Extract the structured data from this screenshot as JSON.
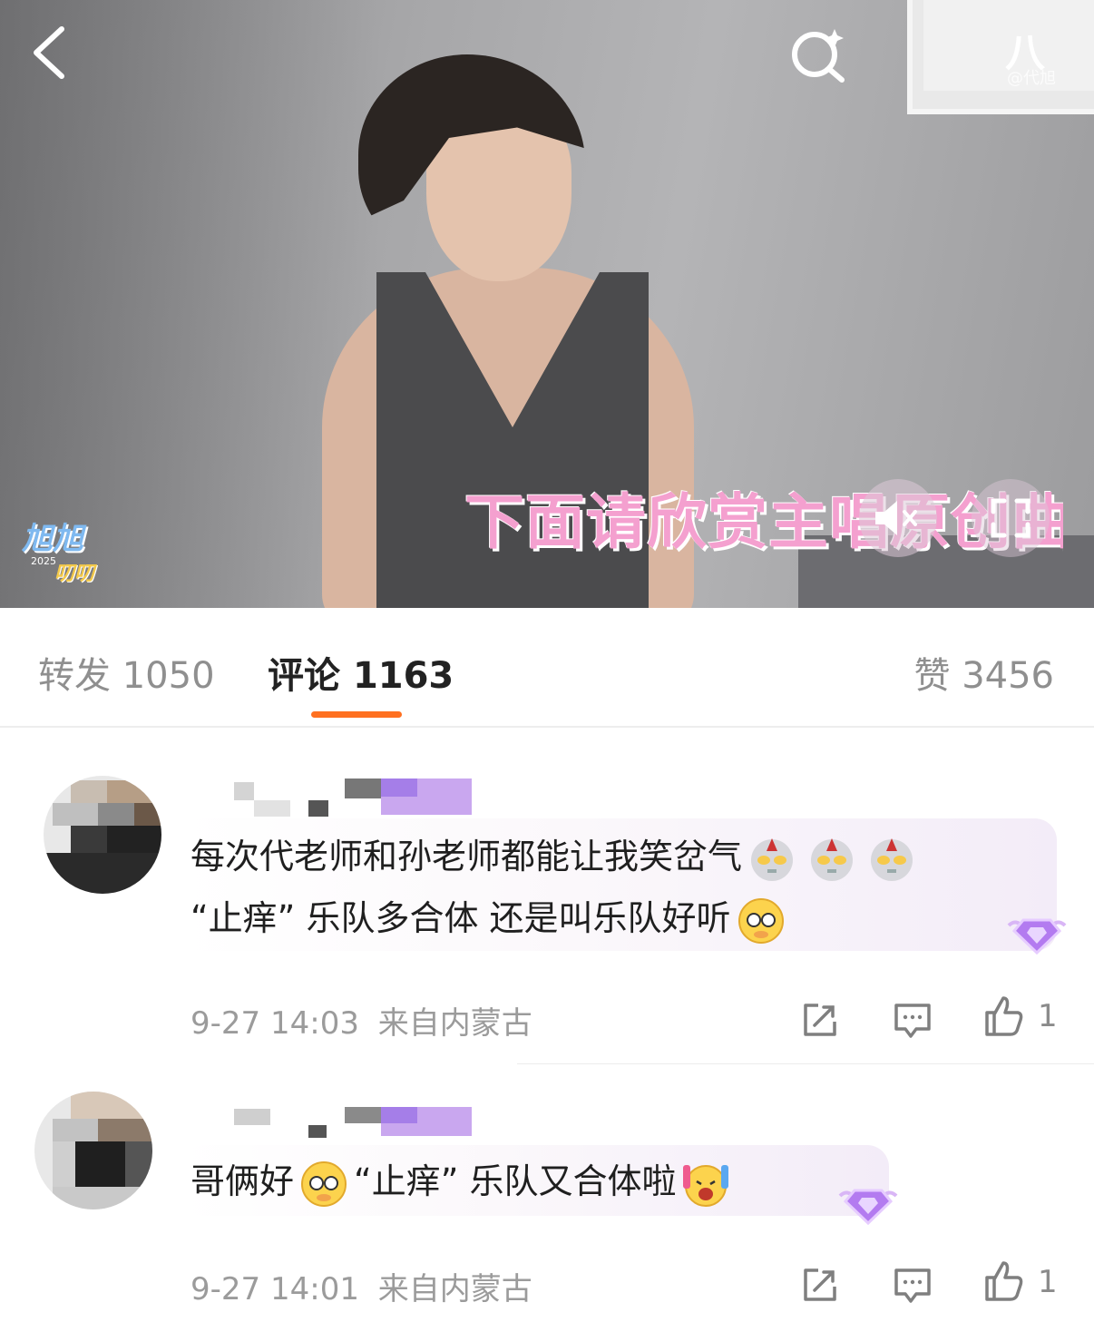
{
  "video": {
    "subtitle": "下面请欣赏主唱原创曲目",
    "channel_logo": {
      "line1": "旭旭",
      "line2": "2025",
      "line3": "叨叨"
    },
    "watermark": "@代旭"
  },
  "tabs": {
    "repost_label": "转发",
    "repost_count": "1050",
    "comments_label": "评论",
    "comments_count": "1163",
    "likes_label": "赞",
    "likes_count": "3456"
  },
  "comments": [
    {
      "text_line1": "每次代老师和孙老师都能让我笑岔气",
      "text_line2_a": "“止痒” 乐队多合体",
      "text_line2_b": "还是叫乐队好听",
      "emojis": [
        "ultraman-emoji",
        "ultraman-emoji",
        "ultraman-emoji",
        "shy-emoji"
      ],
      "time": "9-27 14:03",
      "location": "来自内蒙古",
      "like_count": "1"
    },
    {
      "text_a": "哥俩好",
      "text_b": "“止痒” 乐队又合体啦",
      "emojis": [
        "shy-emoji",
        "cheer-emoji"
      ],
      "time": "9-27 14:01",
      "location": "来自内蒙古",
      "like_count": "1"
    }
  ],
  "colors": {
    "accent": "#ff7020",
    "subtitle": "#f4a0cf",
    "meta": "#9b9b9b"
  }
}
